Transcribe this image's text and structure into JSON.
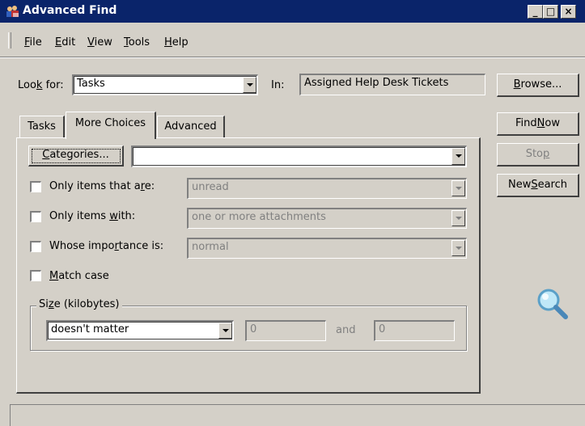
{
  "window": {
    "title": "Advanced Find",
    "title_icon": "people-find-icon",
    "controls": {
      "minimize": "_",
      "maximize": "□",
      "close": "×"
    }
  },
  "menu": [
    {
      "label_u": "F",
      "label_rest": "ile"
    },
    {
      "label_u": "E",
      "label_rest": "dit"
    },
    {
      "label_u": "V",
      "label_rest": "iew"
    },
    {
      "label_u": "T",
      "label_rest": "ools"
    },
    {
      "label_u": "H",
      "label_rest": "elp"
    }
  ],
  "lookfor": {
    "label_pre": "Loo",
    "label_u": "k",
    "label_post": " for:",
    "value": "Tasks",
    "in_label": "In:",
    "in_value": "Assigned Help Desk Tickets"
  },
  "side_buttons": {
    "browse_u": "B",
    "browse_rest": "rowse...",
    "find_pre": "Find ",
    "find_u": "N",
    "find_post": "ow",
    "stop_pre": "Sto",
    "stop_u": "p",
    "new_pre": "New ",
    "new_u": "S",
    "new_post": "earch"
  },
  "tabs": [
    {
      "label": "Tasks",
      "active": false
    },
    {
      "label": "More Choices",
      "active": true
    },
    {
      "label": "Advanced",
      "active": false
    }
  ],
  "more_choices": {
    "categories_button_u": "C",
    "categories_button_rest": "ategories...",
    "categories_value": "",
    "rows": [
      {
        "label": "Only items that are:",
        "label_u_index": 23,
        "value": "unread",
        "checked": false
      },
      {
        "label": "Only items with:",
        "value": "one or more attachments",
        "checked": false
      },
      {
        "label": "Whose importance is:",
        "value": "normal",
        "checked": false
      }
    ],
    "only_items_that_are_pre": "Only items that a",
    "only_items_that_are_u": "r",
    "only_items_that_are_post": "e:",
    "only_items_with_pre": "Only items ",
    "only_items_with_u": "w",
    "only_items_with_post": "ith:",
    "whose_importance_pre": "Whose impo",
    "whose_importance_u": "r",
    "whose_importance_post": "tance is:",
    "match_case_u": "M",
    "match_case_rest": "atch case",
    "match_case_checked": false
  },
  "size": {
    "legend_pre": "Si",
    "legend_u": "z",
    "legend_post": "e (kilobytes)",
    "condition": "doesn't matter",
    "from": "0",
    "and_label": "and",
    "to": "0"
  },
  "icons": {
    "search_graphic": "magnifier-icon"
  },
  "colors": {
    "title_bar": "#0a246a",
    "face": "#d4d0c8",
    "disabled_text": "#808080"
  }
}
